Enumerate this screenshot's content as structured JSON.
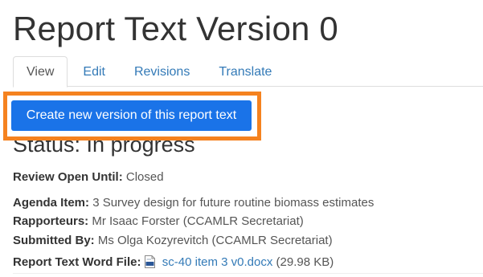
{
  "page": {
    "title": "Report Text Version 0"
  },
  "tabs": [
    {
      "label": "View",
      "active": true
    },
    {
      "label": "Edit",
      "active": false
    },
    {
      "label": "Revisions",
      "active": false
    },
    {
      "label": "Translate",
      "active": false
    }
  ],
  "actions": {
    "create_version_label": "Create new version of this report text",
    "highlight_color": "#f5821f",
    "button_color": "#1a73e8"
  },
  "status": {
    "heading": "Status: In progress"
  },
  "fields": {
    "review_open_until": {
      "label": "Review Open Until:",
      "value": "Closed"
    },
    "agenda_item": {
      "label": "Agenda Item:",
      "value": "3 Survey design for future routine biomass estimates"
    },
    "rapporteurs": {
      "label": "Rapporteurs:",
      "value": "Mr Isaac Forster (CCAMLR Secretariat)"
    },
    "submitted_by": {
      "label": "Submitted By:",
      "value": "Ms Olga Kozyrevitch (CCAMLR Secretariat)"
    },
    "word_file": {
      "label": "Report Text Word File:",
      "icon": "doc-file-icon",
      "file_name": "sc-40 item 3 v0.docx",
      "file_size": "(29.98 KB)"
    }
  }
}
